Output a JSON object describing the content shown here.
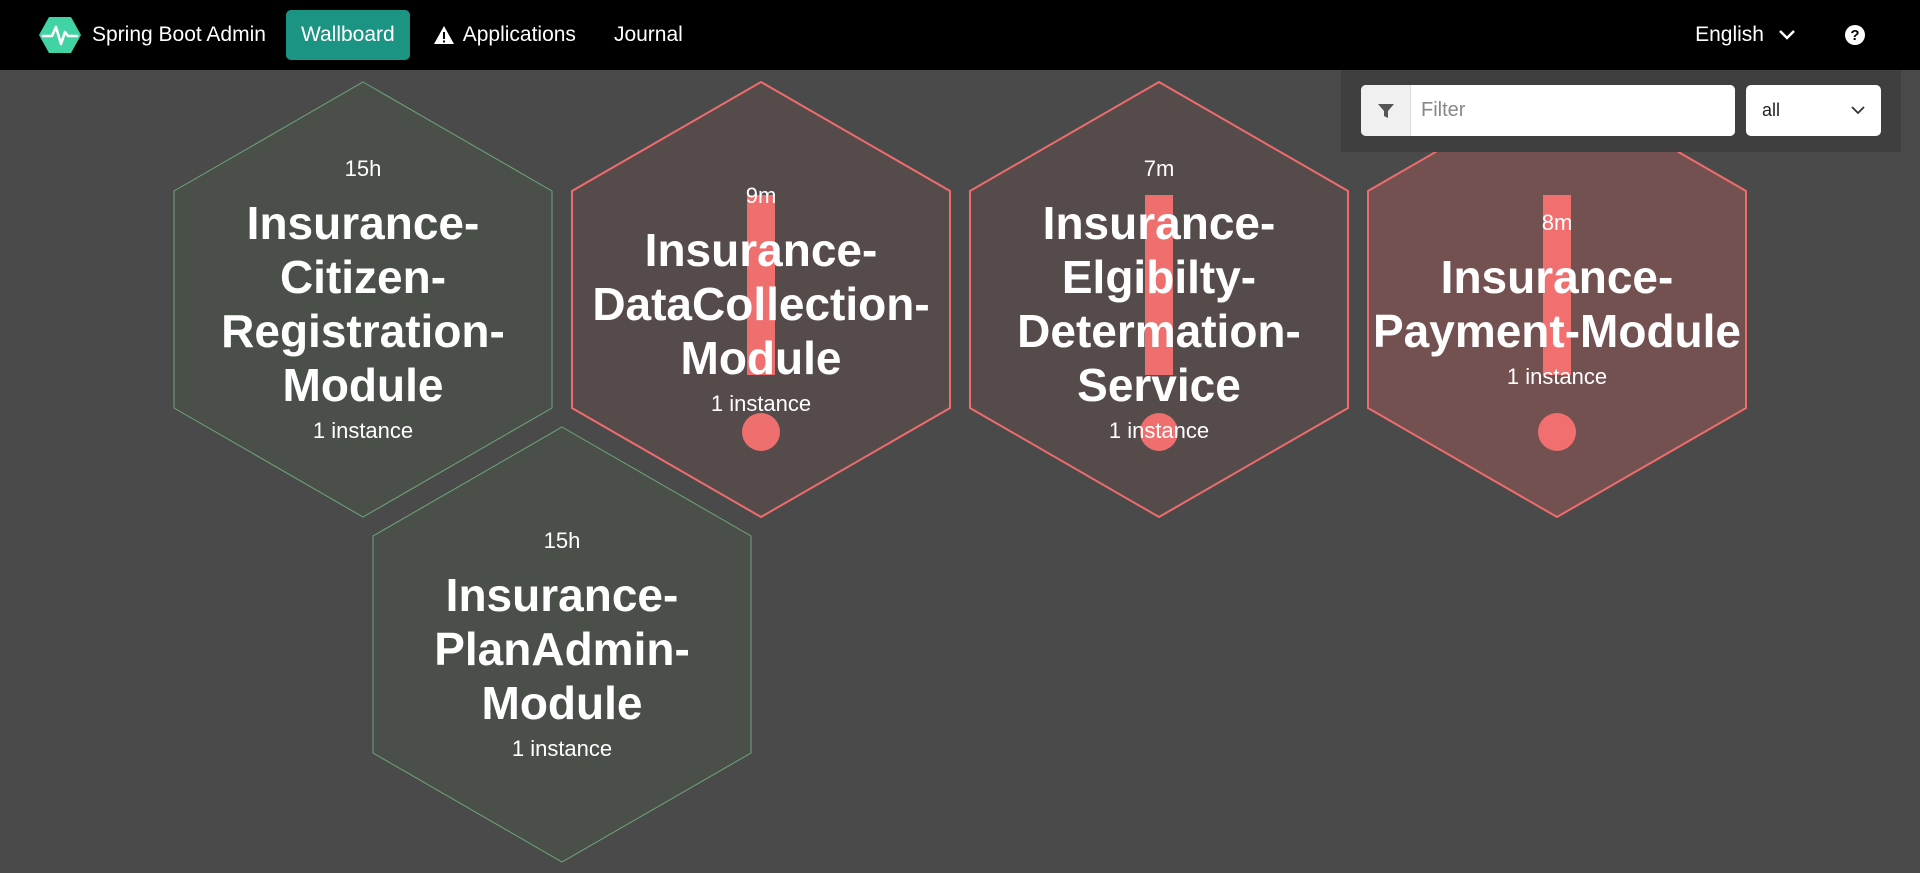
{
  "navbar": {
    "brand": "Spring Boot Admin",
    "items": [
      {
        "label": "Wallboard"
      },
      {
        "label": "Applications"
      },
      {
        "label": "Journal"
      }
    ],
    "language": "English"
  },
  "filter": {
    "placeholder": "Filter",
    "status": "all"
  },
  "colors": {
    "up": "#4a5049",
    "up_stroke": "#6fa57a",
    "down": "#564b4b",
    "down_stroke": "#ee6c6c",
    "offline": "#745151",
    "accent": "#1c9484"
  },
  "applications": [
    {
      "uptime": "15h",
      "name_lines": [
        "Insurance-",
        "Citizen-",
        "Registration-",
        "Module"
      ],
      "instances": "1 instance",
      "status": "up"
    },
    {
      "uptime": "9m",
      "name_lines": [
        "Insurance-",
        "DataCollection-",
        "Module"
      ],
      "instances": "1 instance",
      "status": "down"
    },
    {
      "uptime": "7m",
      "name_lines": [
        "Insurance-",
        "Elgibilty-",
        "Determation-",
        "Service"
      ],
      "instances": "1 instance",
      "status": "down"
    },
    {
      "uptime": "8m",
      "name_lines": [
        "Insurance-",
        "Payment-Module"
      ],
      "instances": "1 instance",
      "status": "offline"
    },
    {
      "uptime": "15h",
      "name_lines": [
        "Insurance-",
        "PlanAdmin-",
        "Module"
      ],
      "instances": "1 instance",
      "status": "up"
    }
  ]
}
